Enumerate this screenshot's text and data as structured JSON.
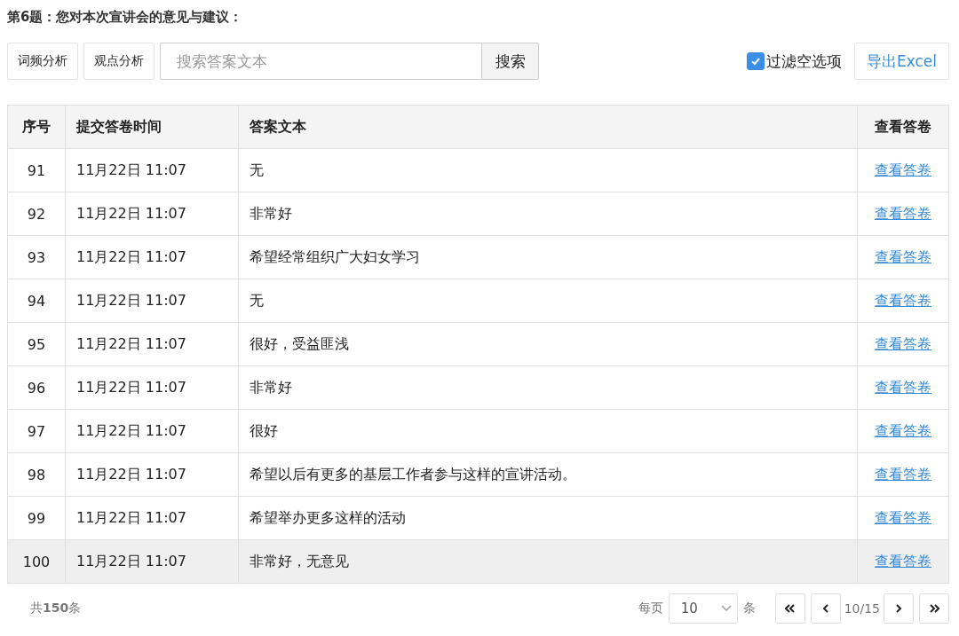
{
  "question_title": "第6题：您对本次宣讲会的意见与建议：",
  "toolbar": {
    "buttons": [
      "词频分析",
      "观点分析"
    ],
    "search": {
      "placeholder": "搜索答案文本",
      "button": "搜索"
    },
    "filter": {
      "label": "过滤空选项",
      "checked": true
    },
    "export_button": "导出Excel"
  },
  "table": {
    "columns": [
      "序号",
      "提交答卷时间",
      "答案文本",
      "查看答卷"
    ],
    "rows": [
      {
        "index": "91",
        "time": "11月22日 11:07",
        "answer": "无",
        "link": "查看答卷",
        "hovered": false
      },
      {
        "index": "92",
        "time": "11月22日 11:07",
        "answer": "非常好",
        "link": "查看答卷",
        "hovered": false
      },
      {
        "index": "93",
        "time": "11月22日 11:07",
        "answer": "希望经常组织广大妇女学习",
        "link": "查看答卷",
        "hovered": false
      },
      {
        "index": "94",
        "time": "11月22日 11:07",
        "answer": "无",
        "link": "查看答卷",
        "hovered": false
      },
      {
        "index": "95",
        "time": "11月22日 11:07",
        "answer": "很好，受益匪浅",
        "link": "查看答卷",
        "hovered": false
      },
      {
        "index": "96",
        "time": "11月22日 11:07",
        "answer": "非常好",
        "link": "查看答卷",
        "hovered": false
      },
      {
        "index": "97",
        "time": "11月22日 11:07",
        "answer": "很好",
        "link": "查看答卷",
        "hovered": false
      },
      {
        "index": "98",
        "time": "11月22日 11:07",
        "answer": "希望以后有更多的基层工作者参与这样的宣讲活动。",
        "link": "查看答卷",
        "hovered": false
      },
      {
        "index": "99",
        "time": "11月22日 11:07",
        "answer": "希望举办更多这样的活动",
        "link": "查看答卷",
        "hovered": false
      },
      {
        "index": "100",
        "time": "11月22日 11:07",
        "answer": "非常好，无意见",
        "link": "查看答卷",
        "hovered": true
      }
    ]
  },
  "footer": {
    "total": "共**150**条",
    "per_page_label": "每页",
    "per_page_value": "10",
    "per_page_unit": "条",
    "page_info": "10/15"
  }
}
